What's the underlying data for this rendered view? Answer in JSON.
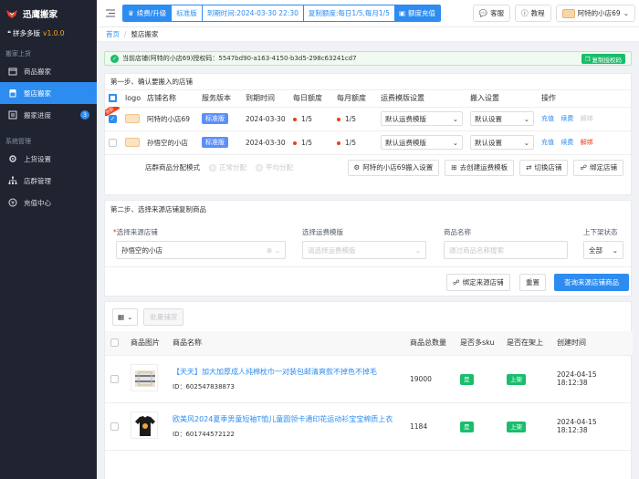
{
  "brand": {
    "name": "迅鹰搬家",
    "sub": "拼多多版",
    "version": "v1.0.0"
  },
  "sidebar": {
    "sections": [
      "搬家上货",
      "系统管理"
    ],
    "items": [
      {
        "label": "商品搬家",
        "icon": "box-icon"
      },
      {
        "label": "整店搬家",
        "icon": "store-icon"
      },
      {
        "label": "搬家进度",
        "icon": "progress-icon",
        "badge": "3"
      },
      {
        "label": "上货设置",
        "icon": "gear-icon"
      },
      {
        "label": "店群管理",
        "icon": "network-icon"
      },
      {
        "label": "充值中心",
        "icon": "recharge-icon"
      }
    ]
  },
  "topbar": {
    "renew": "续费/升级",
    "edition": "标准版",
    "expire": "到期时间:2024-03-30 22:30",
    "quota": "复制额度:每日1/5,每月1/5",
    "recharge": "额度充值",
    "service": "客服",
    "tutorial": "教程",
    "store": "阿特的小店69"
  },
  "breadcrumb": {
    "home": "首页",
    "current": "整店搬家"
  },
  "notice": {
    "text": "当前店铺(阿特的小店69)授权码：5547bd90-a163-4150-b3d5-298c63241cd7",
    "copy": "复制授权码"
  },
  "step1": {
    "title": "第一步、确认要搬入的店铺",
    "headers": [
      "logo",
      "店铺名称",
      "服务版本",
      "到期时间",
      "每日额度",
      "每月额度",
      "运费模版设置",
      "搬入设置",
      "操作"
    ],
    "rows": [
      {
        "name": "阿特的小店69",
        "version": "标准版",
        "expire": "2024-03-30",
        "daily": "1/5",
        "monthly": "1/5",
        "freight": "默认运费模版",
        "move": "默认设置",
        "ops": [
          "充值",
          "续费",
          "解绑"
        ],
        "checked": true,
        "ribbon": "当前"
      },
      {
        "name": "孙悟空的小店",
        "version": "标准版",
        "expire": "2024-03-30",
        "daily": "1/5",
        "monthly": "1/5",
        "freight": "默认运费模版",
        "move": "默认设置",
        "ops": [
          "充值",
          "续费",
          "解绑"
        ],
        "checked": false
      }
    ],
    "dist_label": "店群商品分配模式",
    "dist_normal": "正常分配",
    "dist_avg": "平均分配",
    "btn_move_setting": "阿特的小店69搬入设置",
    "btn_create_freight": "去创建运费模板",
    "btn_switch": "切换店铺",
    "btn_bind": "绑定店铺"
  },
  "step2": {
    "title": "第二步、选择来源店铺复制商品",
    "label_source": "选择来源店铺",
    "source_value": "孙悟空的小店",
    "label_freight": "选择运费模版",
    "freight_ph": "请选择运费模版",
    "label_name": "商品名称",
    "name_ph": "通过商品名称搜索",
    "label_status": "上下架状态",
    "status_value": "全部",
    "btn_bind_source": "绑定来源店铺",
    "btn_reset": "重置",
    "btn_query": "查询来源店铺商品"
  },
  "products": {
    "batch": "批量铺货",
    "headers": [
      "商品图片",
      "商品名称",
      "商品总数量",
      "是否多sku",
      "是否在架上",
      "创建时间"
    ],
    "rows": [
      {
        "title": "【天天】加大加厚成人纯棉枕巾一对装包邮清爽款不掉色不掉毛",
        "id": "ID：602547838873",
        "qty": "19000",
        "multi": "是",
        "onshelf": "上架",
        "date": "2024-04-15",
        "time": "18:12:38"
      },
      {
        "title": "欧美风2024夏季男童短袖T恤儿童圆领卡通印花运动衫宝宝棉质上衣",
        "id": "ID：601744572122",
        "qty": "1184",
        "multi": "是",
        "onshelf": "上架",
        "date": "2024-04-15",
        "time": "18:12:38"
      }
    ]
  },
  "colors": {
    "primary": "#2d8cf0",
    "sidebar": "#1f2430",
    "success": "#19be6b",
    "danger": "#ed4014"
  }
}
